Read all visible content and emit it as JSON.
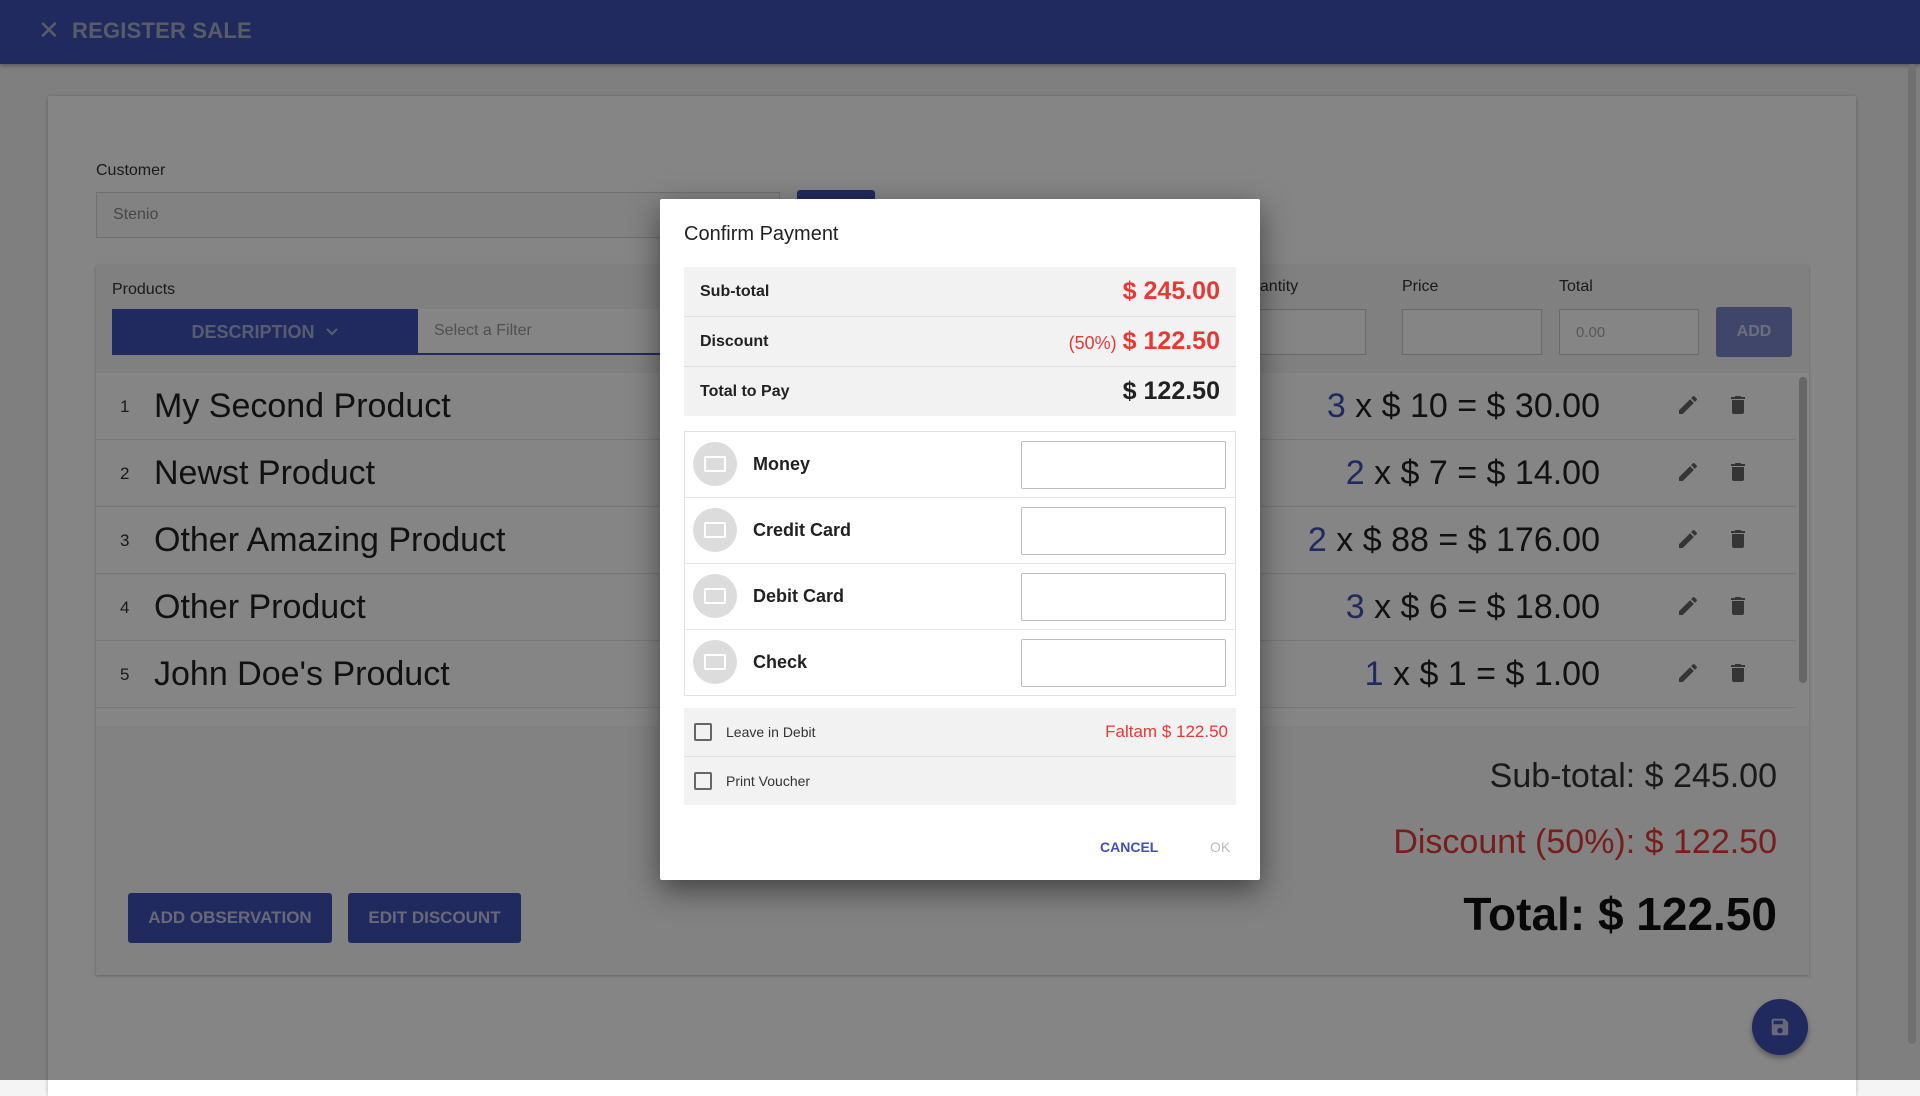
{
  "appbar": {
    "title": "REGISTER SALE"
  },
  "form": {
    "customer_label": "Customer",
    "customer_value": "Stenio",
    "products_label": "Products",
    "filter_button": "DESCRIPTION",
    "filter_placeholder": "Select a Filter",
    "quantity_label": "uantity",
    "price_label": "Price",
    "total_label": "Total",
    "total_placeholder": "0.00",
    "add_label": "ADD"
  },
  "products": [
    {
      "num": "1",
      "name": "My Second Product",
      "qty": "3",
      "calc": " x $ 10 = $ 30.00"
    },
    {
      "num": "2",
      "name": "Newst Product",
      "qty": "2",
      "calc": " x $ 7 = $ 14.00"
    },
    {
      "num": "3",
      "name": "Other Amazing Product",
      "qty": "2",
      "calc": " x $ 88 = $ 176.00"
    },
    {
      "num": "4",
      "name": "Other Product",
      "qty": "3",
      "calc": " x $ 6 = $ 18.00"
    },
    {
      "num": "5",
      "name": "John Doe's Product",
      "qty": "1",
      "calc": " x $ 1 = $ 1.00"
    }
  ],
  "summary": {
    "subtotal": "Sub-total: $ 245.00",
    "discount": "Discount (50%): $ 122.50",
    "total": "Total: $ 122.50"
  },
  "buttons": {
    "add_observation": "ADD OBSERVATION",
    "edit_discount": "EDIT DISCOUNT"
  },
  "dialog": {
    "title": "Confirm Payment",
    "subtotal_label": "Sub-total",
    "subtotal_value": "$ 245.00",
    "discount_label": "Discount",
    "discount_pct": "(50%)",
    "discount_value": "$ 122.50",
    "topay_label": "Total to Pay",
    "topay_value": "$ 122.50",
    "methods": [
      {
        "name": "Money",
        "icon": "money-icon"
      },
      {
        "name": "Credit Card",
        "icon": "credit-card-icon"
      },
      {
        "name": "Debit Card",
        "icon": "debit-card-icon"
      },
      {
        "name": "Check",
        "icon": "check-icon"
      }
    ],
    "leave_debit": "Leave in Debit",
    "missing": "Faltam $ 122.50",
    "print_voucher": "Print Voucher",
    "cancel": "CANCEL",
    "ok": "OK"
  },
  "colors": {
    "primary": "#3f51b5",
    "danger": "#e53935"
  }
}
